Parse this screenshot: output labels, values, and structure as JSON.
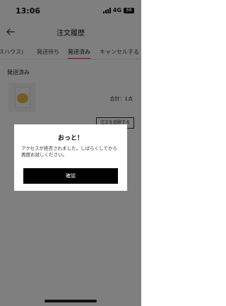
{
  "status_bar": {
    "time": "13:06",
    "network": "4G",
    "battery": "58"
  },
  "header": {
    "title": "注文履歴",
    "back_icon": "arrow-left-icon"
  },
  "tabs": [
    {
      "label": "スハウス)",
      "active": false
    },
    {
      "label": "発送待ち",
      "active": false
    },
    {
      "label": "発送済み",
      "active": true
    },
    {
      "label": "キャンセルする",
      "active": false
    }
  ],
  "order": {
    "section_title": "発送済み",
    "total": "合計：1点",
    "action_label": "注文を追跡する"
  },
  "dialog": {
    "title": "おっと！",
    "message": "アクセスが拒否されました。しばらくしてから再度お試しください。",
    "confirm_label": "確認"
  },
  "colors": {
    "accent": "#c0392b",
    "button_bg": "#000000",
    "overlay": "rgba(0,0,0,0.5)"
  }
}
